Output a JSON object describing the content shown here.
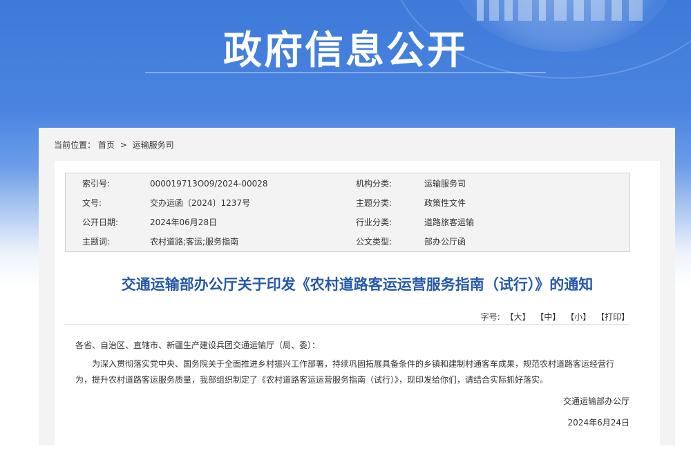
{
  "banner": {
    "title": "政府信息公开"
  },
  "breadcrumb": {
    "label": "当前位置：",
    "home": "首页",
    "separator": ">",
    "current": "运输服务司"
  },
  "meta": {
    "rows": [
      {
        "label1": "索引号:",
        "value1": "000019713O09/2024-00028",
        "label2": "机构分类:",
        "value2": "运输服务司"
      },
      {
        "label1": "文号:",
        "value1": "交办运函〔2024〕1237号",
        "label2": "主题分类:",
        "value2": "政策性文件"
      },
      {
        "label1": "公开日期:",
        "value1": "2024年06月28日",
        "label2": "行业分类:",
        "value2": "道路旅客运输"
      },
      {
        "label1": "主题词:",
        "value1": "农村道路;客运;服务指南",
        "label2": "公文类型:",
        "value2": "部办公厅函"
      }
    ]
  },
  "document": {
    "title": "交通运输部办公厅关于印发《农村道路客运运营服务指南（试行）》的通知",
    "fontsize": {
      "label": "字号:",
      "large": "【大】",
      "medium": "【中】",
      "small": "【小】",
      "print": "【打印】"
    },
    "salutation": "各省、自治区、直辖市、新疆生产建设兵团交通运输厅（局、委）：",
    "paragraph": "为深入贯彻落实党中央、国务院关于全面推进乡村振兴工作部署，持续巩固拓展具备条件的乡镇和建制村通客车成果，规范农村道路客运经营行为，提升农村道路客运服务质量，我部组织制定了《农村道路客运运营服务指南（试行）》，现印发给你们，请结合实际抓好落实。",
    "signer": "交通运输部办公厅",
    "date": "2024年6月24日"
  }
}
